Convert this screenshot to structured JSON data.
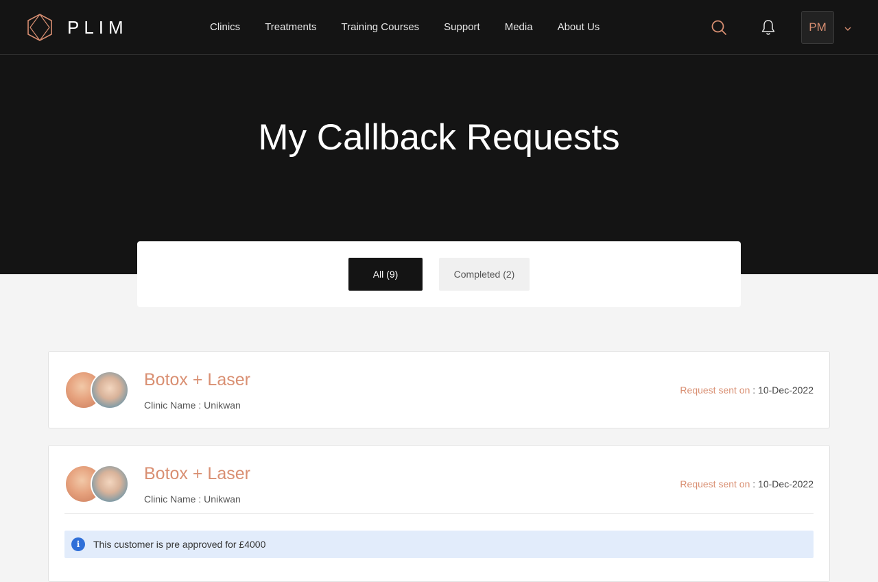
{
  "brand": {
    "name": "PLIM",
    "accent": "#d98f72"
  },
  "nav": [
    "Clinics",
    "Treatments",
    "Training Courses",
    "Support",
    "Media",
    "About Us"
  ],
  "header": {
    "avatar_initials": "PM"
  },
  "hero": {
    "title": "My Callback Requests"
  },
  "tabs": [
    {
      "label": "All (9)",
      "active": true
    },
    {
      "label": "Completed (2)",
      "active": false
    }
  ],
  "requests": [
    {
      "title": "Botox + Laser",
      "clinic_label": "Clinic Name : Unikwan",
      "sent_label": "Request sent on",
      "sent_date": " : 10-Dec-2022"
    },
    {
      "title": "Botox + Laser",
      "clinic_label": "Clinic Name : Unikwan",
      "sent_label": "Request sent on",
      "sent_date": " : 10-Dec-2022",
      "notice": "This customer is pre approved for £4000"
    }
  ]
}
